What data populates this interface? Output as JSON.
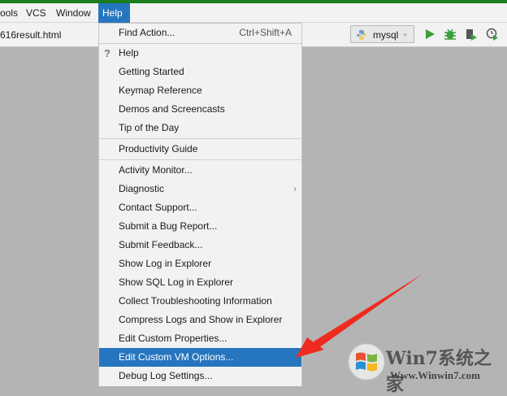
{
  "menubar": {
    "items": [
      {
        "label": "ools"
      },
      {
        "label": "VCS"
      },
      {
        "label": "Window"
      },
      {
        "label": "Help"
      }
    ]
  },
  "toolbar": {
    "file_tab": "616result.html",
    "run_config": "mysql"
  },
  "help_menu": {
    "find_action": {
      "label": "Find Action...",
      "shortcut": "Ctrl+Shift+A"
    },
    "items": [
      {
        "label": "Help"
      },
      {
        "label": "Getting Started"
      },
      {
        "label": "Keymap Reference"
      },
      {
        "label": "Demos and Screencasts"
      },
      {
        "label": "Tip of the Day"
      },
      {
        "label": "Productivity Guide"
      },
      {
        "label": "Activity Monitor..."
      },
      {
        "label": "Diagnostic"
      },
      {
        "label": "Contact Support..."
      },
      {
        "label": "Submit a Bug Report..."
      },
      {
        "label": "Submit Feedback..."
      },
      {
        "label": "Show Log in Explorer"
      },
      {
        "label": "Show SQL Log in Explorer"
      },
      {
        "label": "Collect Troubleshooting Information"
      },
      {
        "label": "Compress Logs and Show in Explorer"
      },
      {
        "label": "Edit Custom Properties..."
      },
      {
        "label": "Edit Custom VM Options..."
      },
      {
        "label": "Debug Log Settings..."
      }
    ]
  },
  "background_fragment": "t",
  "watermark": {
    "title": "Win7系统之家",
    "url": "Www.Winwin7.com"
  },
  "colors": {
    "accent": "#2675bf",
    "arrow": "#f02a1e",
    "run": "#3aa03a"
  }
}
